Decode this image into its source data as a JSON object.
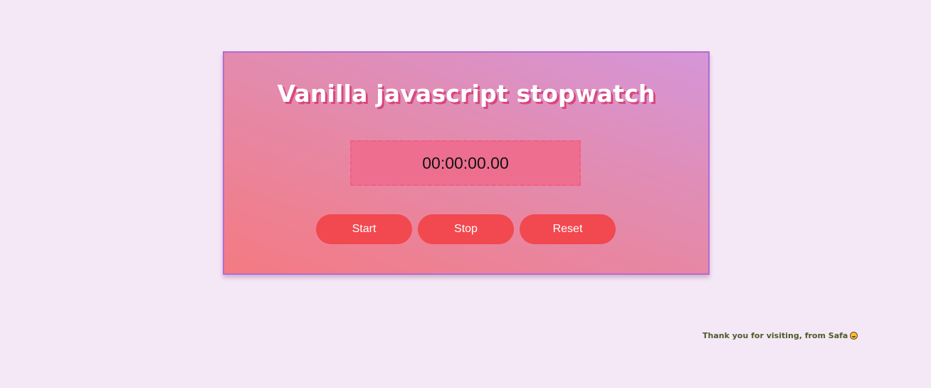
{
  "app": {
    "title": "Vanilla javascript stopwatch"
  },
  "timer": {
    "display": "00:00:00.00"
  },
  "controls": {
    "start_label": "Start",
    "stop_label": "Stop",
    "reset_label": "Reset"
  },
  "footer": {
    "text": "Thank you for visiting, from Safa",
    "icon": "grinning-face-icon"
  },
  "colors": {
    "page_background": "#f5e8f6",
    "card_border": "#b46bd0",
    "button": "#f2484f",
    "title_shadow": "#d8477e"
  }
}
